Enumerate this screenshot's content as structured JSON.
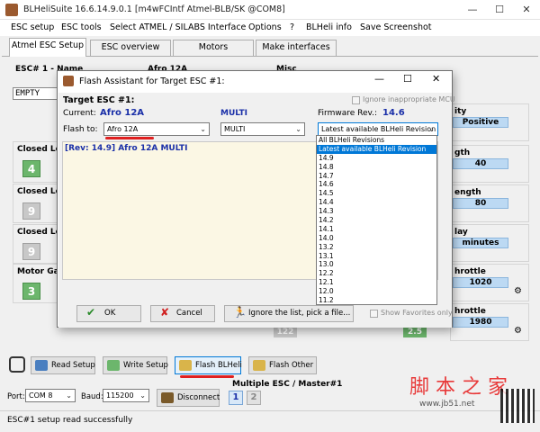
{
  "window": {
    "title": "BLHeliSuite 16.6.14.9.0.1  [m4wFCIntf Atmel-BLB/SK @COM8]",
    "minimize": "—",
    "maximize": "☐",
    "close": "✕"
  },
  "menu": [
    "ESC setup",
    "ESC tools",
    "Select ATMEL / SILABS Interface",
    "Options",
    "?",
    "BLHeli info",
    "Save Screenshot"
  ],
  "tabs": [
    "Atmel ESC Setup",
    "ESC overview",
    "Motors",
    "Make interfaces"
  ],
  "esc_panel": {
    "esc_label": "ESC# 1 - Name",
    "esc_model": "Afro 12A",
    "misc_label": "Misc",
    "empty_field": "EMPTY",
    "groups_left": [
      {
        "label": "Closed Loop",
        "value": "4",
        "style": "green"
      },
      {
        "label": "Closed Loop",
        "value": "9",
        "style": "grey"
      },
      {
        "label": "Closed Loop",
        "value": "9",
        "style": "grey"
      },
      {
        "label": "Motor Gain",
        "value": "3",
        "style": "green"
      }
    ],
    "groups_right": [
      {
        "label": "ity",
        "value": "Positive"
      },
      {
        "label": "gth",
        "value": "40"
      },
      {
        "label": "ength",
        "value": "80"
      },
      {
        "label": "lay",
        "value": "minutes"
      },
      {
        "label": "hrottle",
        "value": "1020"
      },
      {
        "label": "hrottle",
        "value": "1980"
      }
    ],
    "bottom_box_left": "122",
    "bottom_box_right": "2.5"
  },
  "dialog": {
    "title": "Flash Assistant for Target ESC #1:",
    "target_label": "Target ESC #1:",
    "ignore_mcu_label": "Ignore inappropriate MCU",
    "current_label": "Current:",
    "current_value": "Afro 12A",
    "multi_label": "MULTI",
    "firmware_label": "Firmware Rev.:",
    "firmware_value": "14.6",
    "flash_to_label": "Flash to:",
    "flash_to_value": "Afro 12A",
    "mode_value": "MULTI",
    "revision_value": "Latest available BLHeli Revision",
    "log_text": "[Rev: 14.9] Afro 12A MULTI",
    "ok_label": "OK",
    "cancel_label": "Cancel",
    "ignore_list_label": "Ignore the list, pick a file...",
    "show_favorites_label": "Show Favorites only",
    "dropdown_options": [
      "All BLHeli Revisions",
      "Latest available BLHeli Revision",
      "14.9",
      "14.8",
      "14.7",
      "14.6",
      "14.5",
      "14.4",
      "14.3",
      "14.2",
      "14.1",
      "14.0",
      "13.2",
      "13.1",
      "13.0",
      "12.2",
      "12.1",
      "12.0",
      "11.2"
    ],
    "dropdown_selected_index": 1
  },
  "toolbar": {
    "read_setup": "Read Setup",
    "write_setup": "Write Setup",
    "flash_blheli": "Flash BLHeli",
    "flash_other": "Flash Other"
  },
  "port": {
    "port_label": "Port:",
    "port_value": "COM 8",
    "baud_label": "Baud:",
    "baud_value": "115200",
    "disconnect_label": "Disconnect",
    "multiple_esc_label": "Multiple ESC / Master#1",
    "esc_buttons": [
      "1",
      "2"
    ]
  },
  "status": {
    "text": "ESC#1 setup read successfully"
  },
  "watermark": {
    "brand": "脚 本 之 家",
    "url": "www.jb51.net"
  },
  "colors": {
    "highlight": "#0078d7",
    "accent_blue": "#1a2fa8",
    "green_box": "#6cb66c",
    "underline_red": "#e02020"
  }
}
